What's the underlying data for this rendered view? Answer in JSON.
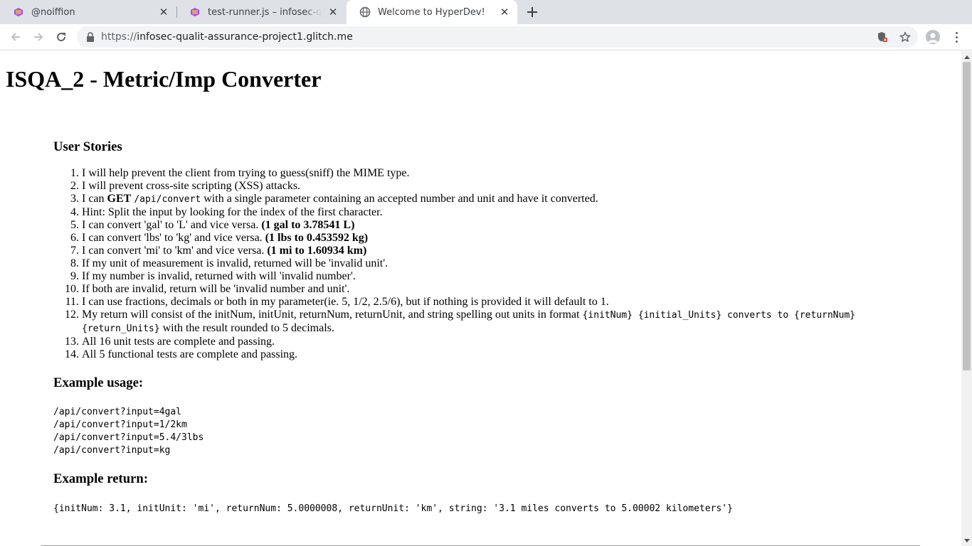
{
  "browser": {
    "tabs": [
      {
        "title": "@noiffion",
        "active": false,
        "icon": "glitch-icon"
      },
      {
        "title": "test-runner.js – infosec-quality",
        "active": false,
        "icon": "glitch-icon"
      },
      {
        "title": "Welcome to HyperDev!",
        "active": true,
        "icon": "globe-icon"
      }
    ],
    "url_scheme": "https://",
    "url_host": "infosec-qualit-assurance-project1.glitch.me"
  },
  "page": {
    "title": "ISQA_2 - Metric/Imp Converter",
    "stories_heading": "User Stories",
    "stories": [
      [
        {
          "t": "I will help prevent the client from trying to guess(sniff) the MIME type."
        }
      ],
      [
        {
          "t": "I will prevent cross-site scripting (XSS) attacks."
        }
      ],
      [
        {
          "t": "I can "
        },
        {
          "t": "GET",
          "b": true
        },
        {
          "t": " "
        },
        {
          "t": "/api/convert",
          "c": true
        },
        {
          "t": " with a single parameter containing an accepted number and unit and have it converted."
        }
      ],
      [
        {
          "t": "Hint: Split the input by looking for the index of the first character."
        }
      ],
      [
        {
          "t": "I can convert 'gal' to 'L' and vice versa. "
        },
        {
          "t": "(1 gal to 3.78541 L)",
          "b": true
        }
      ],
      [
        {
          "t": "I can convert 'lbs' to 'kg' and vice versa. "
        },
        {
          "t": "(1 lbs to 0.453592 kg)",
          "b": true
        }
      ],
      [
        {
          "t": "I can convert 'mi' to 'km' and vice versa. "
        },
        {
          "t": "(1 mi to 1.60934 km)",
          "b": true
        }
      ],
      [
        {
          "t": "If my unit of measurement is invalid, returned will be 'invalid unit'."
        }
      ],
      [
        {
          "t": "If my number is invalid, returned with will 'invalid number'."
        }
      ],
      [
        {
          "t": "If both are invalid, return will be 'invalid number and unit'."
        }
      ],
      [
        {
          "t": "I can use fractions, decimals or both in my parameter(ie. 5, 1/2, 2.5/6), but if nothing is provided it will default to 1."
        }
      ],
      [
        {
          "t": "My return will consist of the initNum, initUnit, returnNum, returnUnit, and string spelling out units in format "
        },
        {
          "t": "{initNum} {initial_Units} converts to {returnNum} {return_Units}",
          "c": true
        },
        {
          "t": " with the result rounded to 5 decimals."
        }
      ],
      [
        {
          "t": "All 16 unit tests are complete and passing."
        }
      ],
      [
        {
          "t": "All 5 functional tests are complete and passing."
        }
      ]
    ],
    "usage_heading": "Example usage:",
    "usage_lines": [
      "/api/convert?input=4gal",
      "/api/convert?input=1/2km",
      "/api/convert?input=5.4/3lbs",
      "/api/convert?input=kg"
    ],
    "return_heading": "Example return:",
    "return_text": "{initNum: 3.1, initUnit: 'mi', returnNum: 5.0000008, returnUnit: 'km', string: '3.1 miles converts to 5.00002 kilometers'}"
  },
  "colors": {
    "tabstrip_bg": "#dee1e6",
    "omnibox_bg": "#f1f3f4",
    "glitch_icon": "#a34df2"
  }
}
